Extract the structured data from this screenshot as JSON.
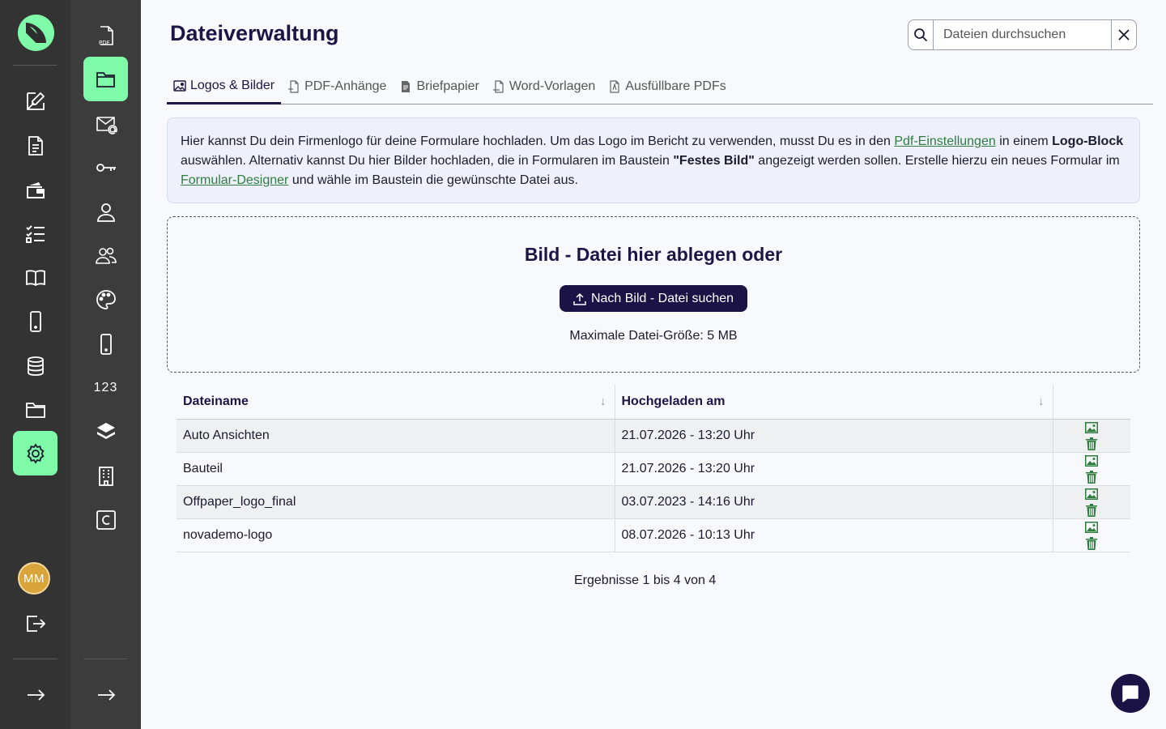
{
  "sidebar": {
    "avatar_initials": "MM",
    "primary_items": [
      "edit-doc-icon",
      "document-icon",
      "wallet-icon",
      "checklist-icon",
      "book-icon",
      "mobile-icon",
      "database-icon",
      "folder-icon",
      "settings-icon"
    ],
    "secondary_counter": "123"
  },
  "header": {
    "title": "Dateiverwaltung",
    "search_placeholder": "Dateien durchsuchen"
  },
  "tabs": [
    {
      "label": "Logos & Bilder",
      "active": true
    },
    {
      "label": "PDF-Anhänge",
      "active": false
    },
    {
      "label": "Briefpapier",
      "active": false
    },
    {
      "label": "Word-Vorlagen",
      "active": false
    },
    {
      "label": "Ausfüllbare PDFs",
      "active": false
    }
  ],
  "info": {
    "t1": "Hier kannst Du dein Firmenlogo für deine Formulare hochladen. Um das Logo im Bericht zu verwenden, musst Du es in den ",
    "link1": "Pdf-Einstellungen",
    "t2": " in einem ",
    "b1": "Logo-Block",
    "t3": " auswählen. Alternativ kannst Du hier Bilder hochladen, die in Formularen im Baustein ",
    "b2": "\"Festes Bild\"",
    "t4": " angezeigt werden sollen. Erstelle hierzu ein neues Formular im ",
    "link2": "Formular-Designer",
    "t5": " und wähle im Baustein die gewünschte Datei aus."
  },
  "dropzone": {
    "title": "Bild - Datei hier ablegen oder",
    "button": "Nach Bild - Datei suchen",
    "max_size": "Maximale Datei-Größe: 5 MB"
  },
  "table": {
    "headers": [
      "Dateiname",
      "Hochgeladen am"
    ],
    "rows": [
      {
        "name": "Auto Ansichten",
        "date": "21.07.2026 - 13:20 Uhr"
      },
      {
        "name": "Bauteil",
        "date": "21.07.2026 - 13:20 Uhr"
      },
      {
        "name": "Offpaper_logo_final",
        "date": "03.07.2023 - 14:16 Uhr"
      },
      {
        "name": "novademo-logo",
        "date": "08.07.2026 - 10:13 Uhr"
      }
    ]
  },
  "results": "Ergebnisse 1 bis 4 von 4",
  "colors": {
    "accent": "#7efaa9",
    "primary": "#1b1246",
    "link": "#2f7d3e"
  }
}
